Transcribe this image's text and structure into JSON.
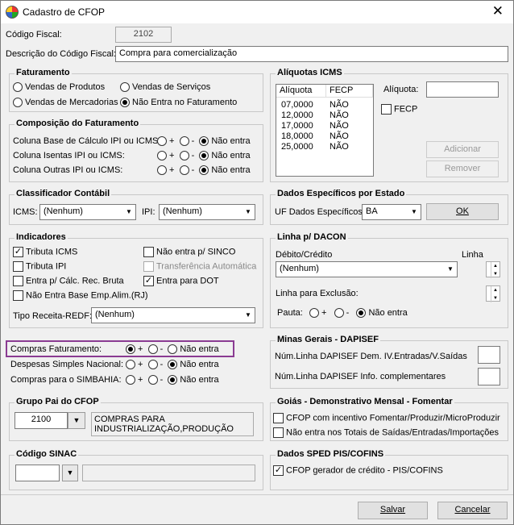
{
  "window": {
    "title": "Cadastro de CFOP",
    "close": "✕"
  },
  "top": {
    "codigo_label": "Código Fiscal:",
    "codigo_value": "2102",
    "descricao_label": "Descrição do Código Fiscal:",
    "descricao_value": "Compra para comercialização"
  },
  "faturamento": {
    "title": "Faturamento",
    "options": [
      "Vendas de Produtos",
      "Vendas de Serviços",
      "Vendas de Mercadorias",
      "Não Entra no Faturamento"
    ],
    "selected": "Não Entra no Faturamento"
  },
  "composicao": {
    "title": "Composição do Faturamento",
    "rows": [
      {
        "label": "Coluna Base de Cálculo IPI ou ICMS:",
        "selected": "Não entra"
      },
      {
        "label": "Coluna Isentas IPI ou ICMS:",
        "selected": "Não entra"
      },
      {
        "label": "Coluna Outras IPI ou ICMS:",
        "selected": "Não entra"
      }
    ],
    "opt_plus": "+",
    "opt_minus": "-",
    "opt_none": "Não entra"
  },
  "aliquotas": {
    "title": "Alíquotas ICMS",
    "col_aliquota": "Alíquota",
    "col_fecp": "FECP",
    "rows": [
      {
        "aliquota": "07,0000",
        "fecp": "NÃO"
      },
      {
        "aliquota": "12,0000",
        "fecp": "NÃO"
      },
      {
        "aliquota": "17,0000",
        "fecp": "NÃO"
      },
      {
        "aliquota": "18,0000",
        "fecp": "NÃO"
      },
      {
        "aliquota": "25,0000",
        "fecp": "NÃO"
      }
    ],
    "aliquota_label": "Alíquota:",
    "fecp_label": "FECP",
    "adicionar": "Adicionar",
    "remover": "Remover"
  },
  "classificador": {
    "title": "Classificador Contábil",
    "icms_label": "ICMS:",
    "icms_value": "(Nenhum)",
    "ipi_label": "IPI:",
    "ipi_value": "(Nenhum)"
  },
  "dados_estado": {
    "title": "Dados Específicos por Estado",
    "uf_label": "UF Dados Específicos:",
    "uf_value": "BA",
    "ok": "OK"
  },
  "indicadores": {
    "title": "Indicadores",
    "items": [
      {
        "label": "Tributa ICMS",
        "checked": true
      },
      {
        "label": "Tributa IPI",
        "checked": false
      },
      {
        "label": "Entra p/ Cálc. Rec. Bruta",
        "checked": false
      },
      {
        "label": "Não Entra Base Emp.Alim.(RJ)",
        "checked": false
      },
      {
        "label": "Não entra p/ SINCO",
        "checked": false
      },
      {
        "label": "Transferência Automática",
        "checked": false
      },
      {
        "label": "Entra para DOT",
        "checked": true
      }
    ],
    "tipo_receita_label": "Tipo Receita-REDF:",
    "tipo_receita_value": "(Nenhum)"
  },
  "dacon": {
    "title": "Linha p/ DACON",
    "debito_label": "Débito/Crédito",
    "debito_value": "(Nenhum)",
    "linha_label": "Linha",
    "exclusao_label": "Linha para Exclusão:",
    "pauta_label": "Pauta:",
    "opt_plus": "+",
    "opt_minus": "-",
    "opt_none": "Não entra"
  },
  "simples": {
    "rows": [
      {
        "label": "Compras Faturamento:",
        "selected": "+"
      },
      {
        "label": "Despesas Simples Nacional:",
        "selected": "Não entra"
      },
      {
        "label": "Compras para o SIMBAHIA:",
        "selected": "Não entra"
      }
    ],
    "opt_plus": "+",
    "opt_minus": "-",
    "opt_none": "Não entra"
  },
  "minas": {
    "title": "Minas Gerais - DAPISEF",
    "row1": "Núm.Linha DAPISEF Dem. IV.Entradas/V.Saídas",
    "row2": "Núm.Linha DAPISEF Info. complementares"
  },
  "grupo_pai": {
    "title": "Grupo Pai do CFOP",
    "code": "2100",
    "desc_line1": "COMPRAS PARA",
    "desc_line2": "INDUSTRIALIZAÇÃO,PRODUÇÃO"
  },
  "goias": {
    "title": "Goiás - Demonstrativo Mensal - Fomentar",
    "item1": "CFOP com incentivo  Fomentar/Produzir/MicroProduzir",
    "item2": "Não entra nos Totais de  Saídas/Entradas/Importações"
  },
  "sinac": {
    "title": "Código SINAC"
  },
  "sped": {
    "title": "Dados SPED PIS/COFINS",
    "item1": "CFOP gerador de crédito - PIS/COFINS",
    "item1_checked": true
  },
  "footer": {
    "salvar": "Salvar",
    "cancelar": "Cancelar"
  }
}
